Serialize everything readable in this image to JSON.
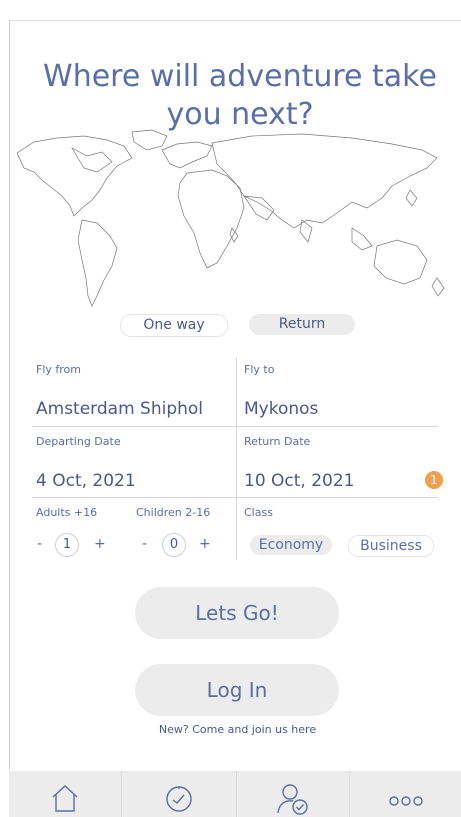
{
  "headline": "Where will adventure take you next?",
  "trip_type": {
    "one_way": "One way",
    "return": "Return",
    "selected": "Return"
  },
  "fly_from": {
    "label": "Fly from",
    "value": "Amsterdam Shiphol"
  },
  "fly_to": {
    "label": "Fly to",
    "value": "Mykonos"
  },
  "departing": {
    "label": "Departing Date",
    "value": "4 Oct, 2021"
  },
  "return_date": {
    "label": "Return Date",
    "value": "10 Oct, 2021"
  },
  "badge": "1",
  "adults": {
    "label": "Adults +16",
    "minus": "-",
    "plus": "+",
    "value": "1"
  },
  "children": {
    "label": "Children 2-16",
    "minus": "-",
    "plus": "+",
    "value": "0"
  },
  "travel_class": {
    "label": "Class",
    "economy": "Economy",
    "business": "Business",
    "selected": "Economy"
  },
  "actions": {
    "go": "Lets Go!",
    "login": "Log In",
    "join": "New? Come and join us here"
  },
  "bottom_nav": {
    "icons": [
      "home-icon",
      "clock-icon",
      "user-check-icon",
      "more-icon"
    ]
  },
  "colors": {
    "accent": "#5a6ea8",
    "badge": "#f2a04a",
    "pill": "#ececec"
  }
}
